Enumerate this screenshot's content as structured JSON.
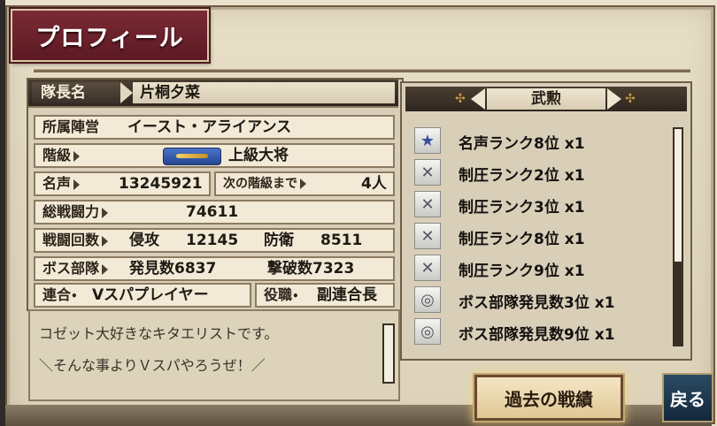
{
  "screen": {
    "title": "プロフィール"
  },
  "profile": {
    "leader_label": "隊長名",
    "leader_name": "片桐夕菜",
    "faction_label": "所属陣営",
    "faction_value": "イースト・アライアンス",
    "rank_label": "階級",
    "rank_value": "上級大将",
    "fame_label": "名声",
    "fame_value": "13245921",
    "next_rank_label": "次の階級まで",
    "next_rank_value": "4人",
    "power_label": "総戦闘力",
    "power_value": "74611",
    "battles_label": "戦闘回数",
    "invade_label": "侵攻",
    "invade_value": "12145",
    "defend_label": "防衛",
    "defend_value": "8511",
    "boss_label": "ボス部隊",
    "boss_found": "発見数6837",
    "boss_killed": "撃破数7323",
    "union_label": "連合",
    "union_value": "Vスパプレイヤー",
    "role_label": "役職",
    "role_value": "副連合長"
  },
  "comment": {
    "line1": "コゼット大好きなキタエリストです。",
    "line2": "＼そんな事よりＶスパやろうぜ！／"
  },
  "medals": {
    "title": "武勲",
    "items": [
      {
        "icon": "star-medal-icon",
        "label": "名声ランク8位 x1"
      },
      {
        "icon": "crossed-swords-icon",
        "label": "制圧ランク2位 x1"
      },
      {
        "icon": "crossed-swords-icon",
        "label": "制圧ランク3位 x1"
      },
      {
        "icon": "crossed-swords-icon",
        "label": "制圧ランク8位 x1"
      },
      {
        "icon": "crossed-swords-icon",
        "label": "制圧ランク9位 x1"
      },
      {
        "icon": "binoculars-icon",
        "label": "ボス部隊発見数3位 x1"
      },
      {
        "icon": "binoculars-icon",
        "label": "ボス部隊発見数9位 x1"
      }
    ]
  },
  "buttons": {
    "history": "過去の戦績",
    "back": "戻る"
  }
}
